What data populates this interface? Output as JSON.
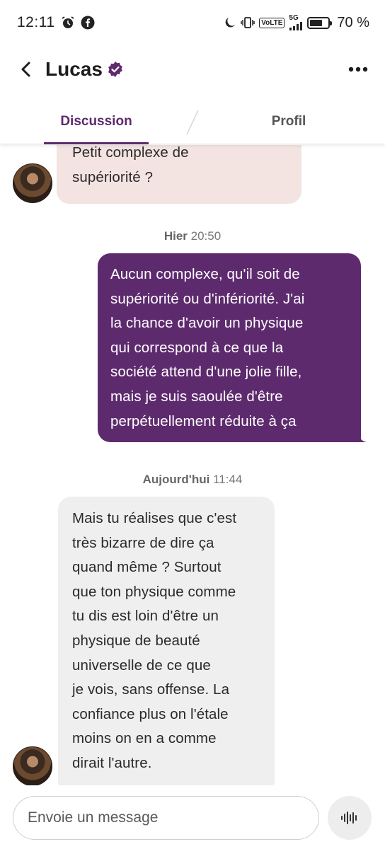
{
  "status_bar": {
    "time": "12:11",
    "battery_percent": "70 %",
    "battery_level": 0.7,
    "volte_label": "VoLTE",
    "network_label": "5G",
    "icons": [
      "alarm-icon",
      "facebook-icon",
      "moon-icon",
      "vibrate-icon",
      "volte-icon",
      "signal-icon",
      "battery-icon"
    ]
  },
  "header": {
    "contact_name": "Lucas",
    "verified": true,
    "icons": [
      "back-arrow-icon",
      "verified-badge-icon",
      "more-options-icon"
    ]
  },
  "tabs": [
    {
      "label": "Discussion",
      "active": true
    },
    {
      "label": "Profil",
      "active": false
    }
  ],
  "messages": [
    {
      "direction": "incoming",
      "text": "Petit complexe de\nsupériorité ?"
    },
    {
      "direction": "outgoing",
      "text": "Aucun complexe, qu'il soit de\nsupériorité ou d'infériorité. J'ai\nla chance d'avoir un physique\nqui correspond à ce que la\nsociété attend d'une jolie fille,\nmais je suis saoulée d'être\nperpétuellement réduite à ça"
    },
    {
      "direction": "incoming",
      "text": "Mais tu réalises que c'est\ntrès bizarre de dire ça\nquand même ? Surtout\nque ton physique comme\ntu dis est loin d'être un\nphysique de beauté\nuniverselle de ce que\nje vois, sans offense. La\nconfiance plus on l'étale\nmoins on en a comme\ndirait l'autre."
    }
  ],
  "timestamps": [
    {
      "day": "Hier",
      "time": "20:50"
    },
    {
      "day": "Aujourd'hui",
      "time": "11:44"
    }
  ],
  "composer": {
    "placeholder": "Envoie un message",
    "icons": [
      "voice-message-icon"
    ]
  },
  "colors": {
    "accent": "#5e2a6e",
    "incoming_pink": "#f3e3e1",
    "incoming_grey": "#efefef"
  }
}
